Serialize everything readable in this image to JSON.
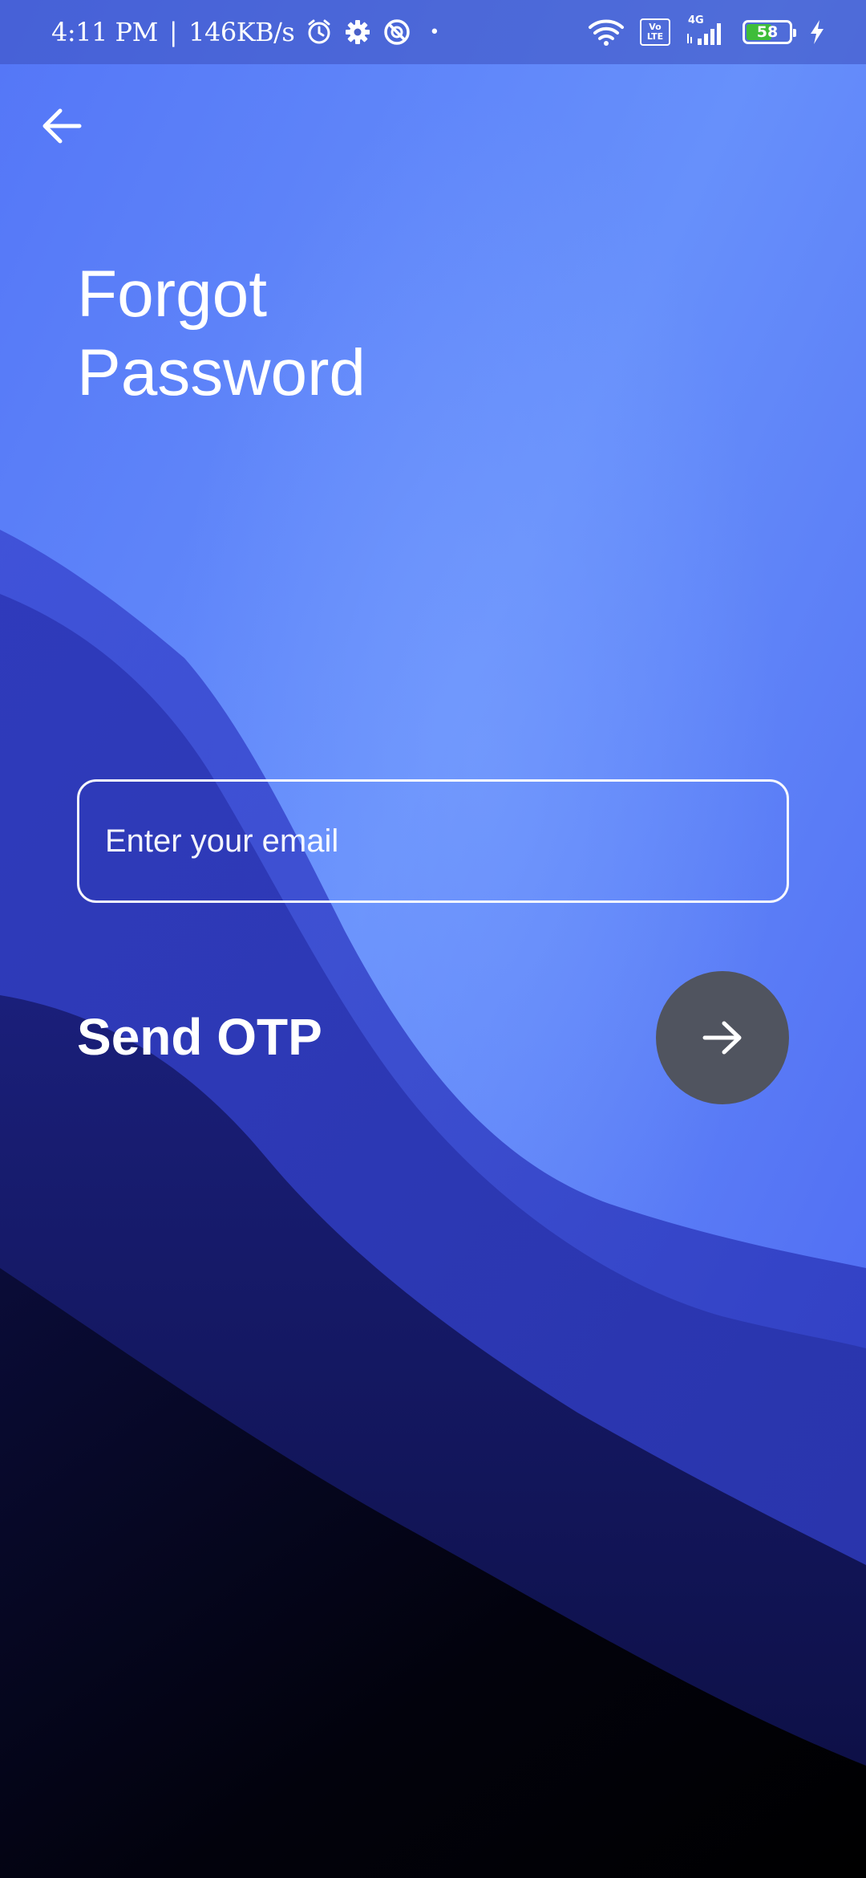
{
  "status_bar": {
    "time": "4:11 PM",
    "separator": "|",
    "network_speed": "146KB/s",
    "dot": "•",
    "volte_top": "Vo",
    "volte_bottom": "LTE",
    "network_type": "4G",
    "battery_level": "58",
    "battery_fraction": 0.58,
    "left_icons": [
      "alarm-icon",
      "gear-icon",
      "blocked-circle-icon"
    ],
    "right_icons": [
      "wifi-icon",
      "volte-icon",
      "signal-icon",
      "battery-icon",
      "charging-icon"
    ]
  },
  "header": {
    "back_icon": "arrow-left-icon"
  },
  "main": {
    "title_line1": "Forgot",
    "title_line2": "Password",
    "email_placeholder": "Enter your email",
    "email_value": "",
    "send_label": "Send OTP",
    "send_icon": "arrow-right-icon"
  },
  "colors": {
    "background_top": "#5a7cf8",
    "background_bottom": "#000000",
    "send_button": "#50545f",
    "battery_fill": "#3fbd3a"
  }
}
